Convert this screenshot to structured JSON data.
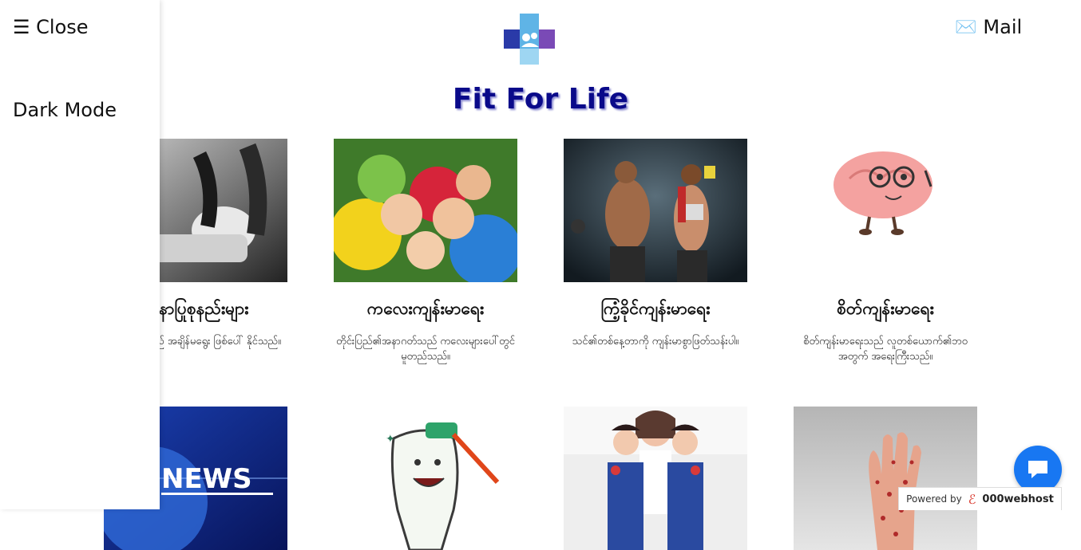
{
  "sidebar": {
    "close_label": "☰ Close",
    "dark_mode_label": "Dark Mode"
  },
  "header": {
    "site_title": "Fit For Life",
    "mail_label": "Mail",
    "mail_icon": "envelope-icon"
  },
  "cards": [
    {
      "title": "သူနာပြုစုနည်းများ",
      "desc": "အခြေနေသည် အချိန်မရွေး ဖြစ်ပေါ် နိုင်သည်။"
    },
    {
      "title": "ကလေးကျန်းမာရေး",
      "desc": "တိုင်းပြည်၏အနာဂတ်သည် ကလေးများပေါ်တွင်မူတည်သည်။"
    },
    {
      "title": "ကြံ့ခိုင်ကျန်းမာရေး",
      "desc": "သင်၏တစ်နေ့တာကို ကျန်းမာစွာဖြတ်သန်းပါ။"
    },
    {
      "title": "စိတ်ကျန်းမာရေး",
      "desc": "စိတ်ကျန်းမာရေးသည် လူတစ်ယောက်၏ဘဝအတွက် အရေးကြီးသည်။"
    }
  ],
  "second_row": {
    "news_text": "NEWS"
  },
  "chat": {
    "icon": "chat-bubble-icon",
    "powered_by": "Powered by",
    "host": "000webhost"
  },
  "colors": {
    "title": "#0a0a8a",
    "chat": "#1877f2"
  }
}
